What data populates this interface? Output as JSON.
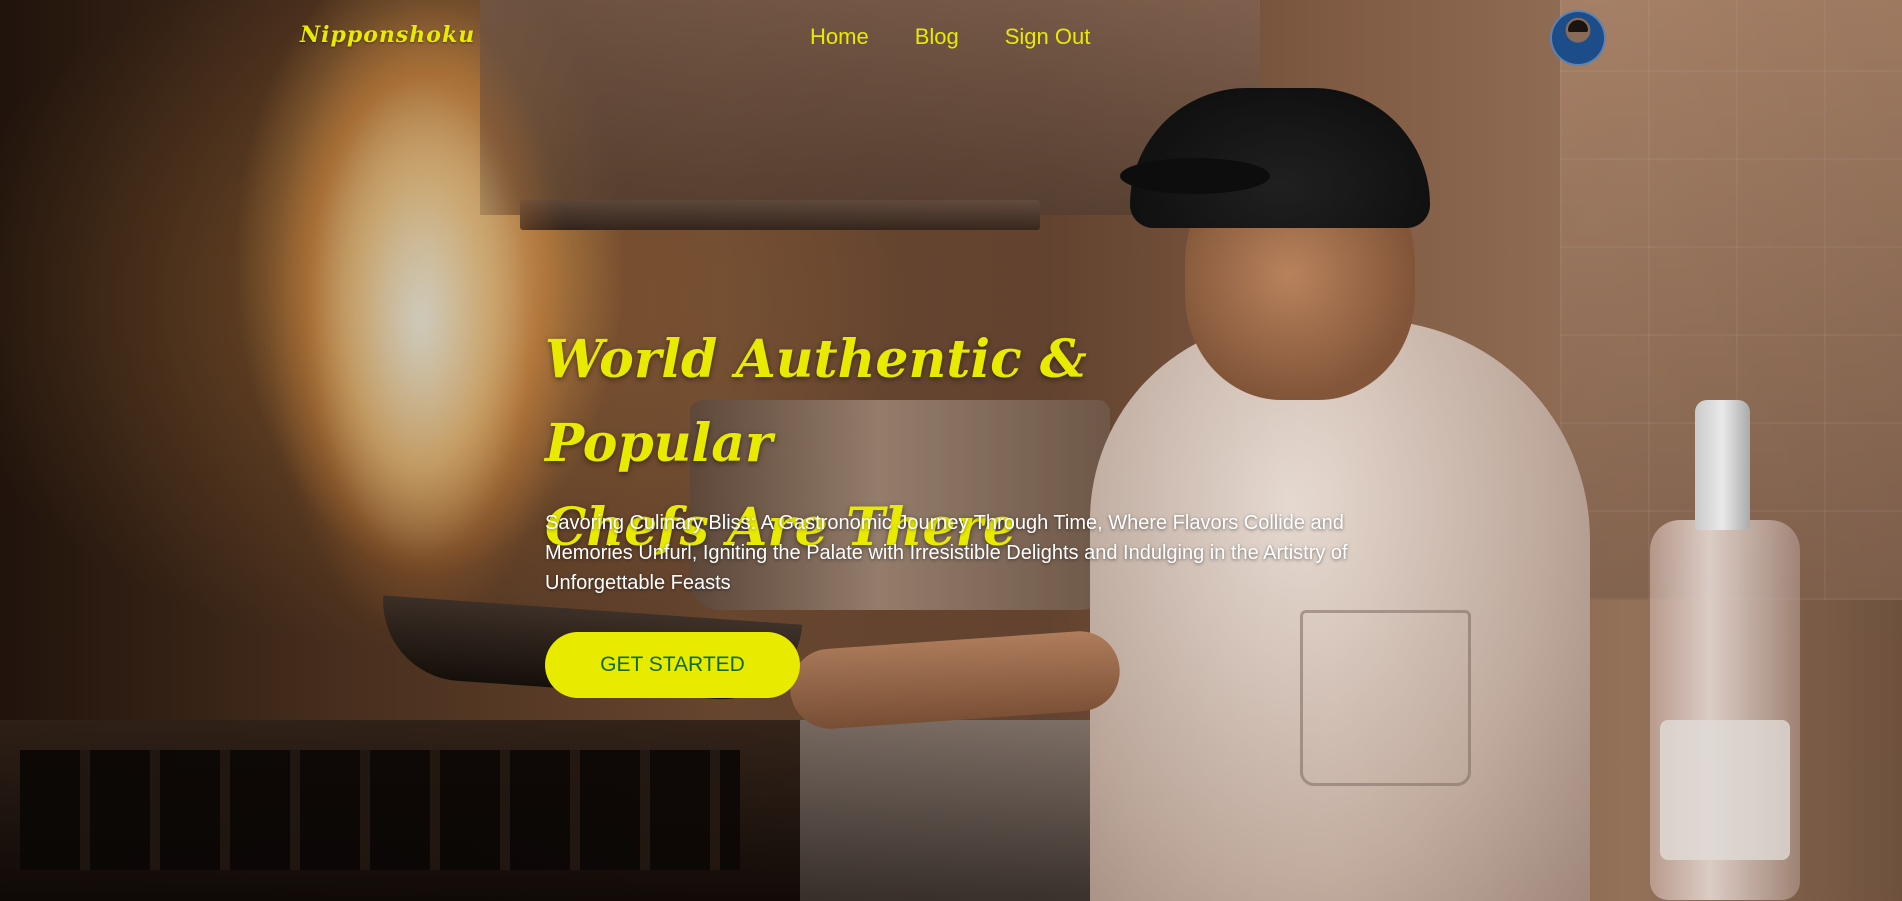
{
  "navbar": {
    "logo": "Nipponshoku",
    "links": [
      {
        "label": "Home"
      },
      {
        "label": "Blog"
      },
      {
        "label": "Sign Out"
      }
    ],
    "avatar_icon": "user-avatar-icon"
  },
  "hero": {
    "headline_line1": "World Authentic & Popular",
    "headline_line2": "Chefs Are There",
    "subtext": "Savoring Culinary Bliss: A Gastronomic Journey Through Time, Where Flavors Collide and Memories Unfurl, Igniting the Palate with Irresistible Delights and Indulging in the Artistry of Unforgettable Feasts",
    "cta_label": "GET STARTED",
    "background_description": "Chef flambéing in a professional kitchen"
  },
  "colors": {
    "accent": "#e8ea00",
    "cta_text": "#0f6a2a",
    "body_text": "#ffffff"
  }
}
